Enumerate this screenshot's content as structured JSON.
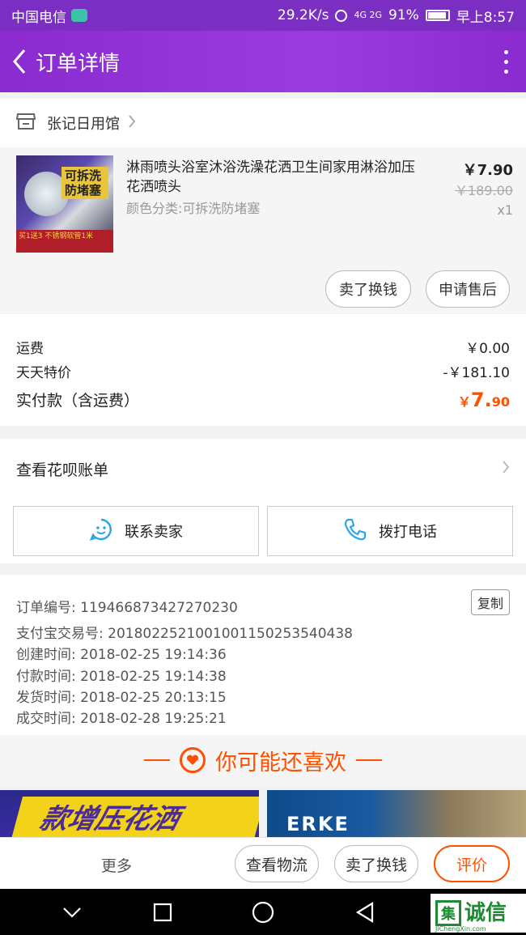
{
  "status_bar": {
    "carrier": "中国电信",
    "speed": "29.2K/s",
    "signal": "4G 2G",
    "battery": "91%",
    "time": "早上8:57"
  },
  "header": {
    "title": "订单详情"
  },
  "store": {
    "name": "张记日用馆"
  },
  "product": {
    "image_tag": "可拆洗防堵塞",
    "image_band": "买1送3 不锈钢软管1米",
    "title": "淋雨喷头浴室沐浴洗澡花洒卫生间家用淋浴加压花洒喷头",
    "attr": "颜色分类:可拆洗防堵塞",
    "price": "￥7.90",
    "original_price": "￥189.00",
    "quantity": "x1",
    "sell_button": "卖了换钱",
    "aftersale_button": "申请售后"
  },
  "fees": {
    "shipping_label": "运费",
    "shipping_value": "￥0.00",
    "discount_label": "天天特价",
    "discount_value": "-￥181.10",
    "total_label": "实付款（含运费）",
    "total_currency": "￥",
    "total_int": "7.",
    "total_dec": "90"
  },
  "huabei": {
    "label": "查看花呗账单"
  },
  "contact": {
    "seller_label": "联系卖家",
    "call_label": "拨打电话"
  },
  "order_info": {
    "order_no": "订单编号: 119466873427270230",
    "copy": "复制",
    "alipay_no": "支付宝交易号: 2018022521001001150253540438",
    "created": "创建时间: 2018-02-25 19:14:36",
    "paid": "付款时间: 2018-02-25 19:14:38",
    "shipped": "发货时间: 2018-02-25 20:13:15",
    "completed": "成交时间: 2018-02-28 19:25:21"
  },
  "recommend": {
    "title": "你可能还喜欢",
    "left_banner": "款增压花洒",
    "right_logo": "ERKE"
  },
  "action_bar": {
    "more": "更多",
    "logistics": "查看物流",
    "sell": "卖了换钱",
    "rate": "评价"
  },
  "watermark": {
    "box": "集",
    "text": "诚信",
    "sub": "JiChengXin.com"
  },
  "colors": {
    "header_purple": "#8a2bd0",
    "accent_orange": "#ff5000"
  }
}
